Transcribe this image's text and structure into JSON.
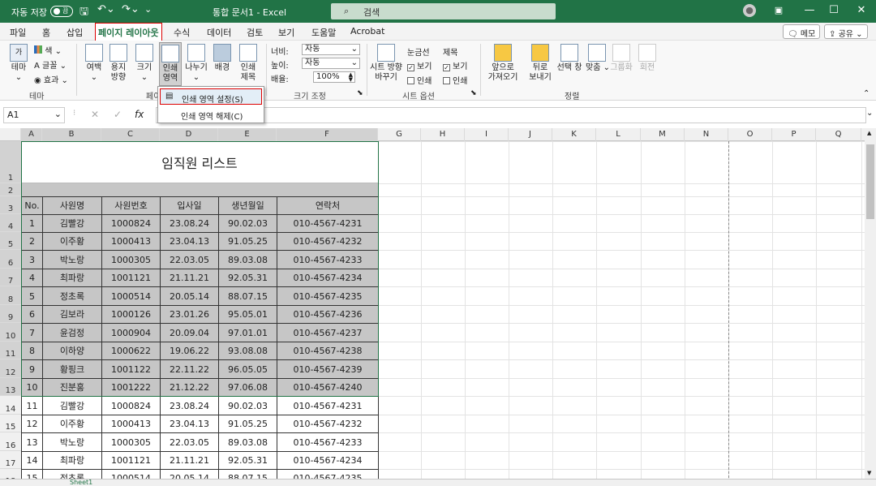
{
  "titlebar": {
    "autosave": "자동 저장",
    "autosave_state": "끔",
    "title": "통합 문서1  -  Excel",
    "search": "검색"
  },
  "menu": {
    "tabs": [
      "파일",
      "홈",
      "삽입",
      "페이지 레이아웃",
      "수식",
      "데이터",
      "검토",
      "보기",
      "도움말",
      "Acrobat"
    ],
    "selected": "페이지 레이아웃",
    "memo": "메모",
    "share": "공유"
  },
  "ribbon": {
    "theme": {
      "themes": "테마",
      "colors": "색",
      "fonts": "글꼴",
      "effects": "효과",
      "group": "테마"
    },
    "page_setup": {
      "margins": "여백",
      "orientation": "용지\n방향",
      "size": "크기",
      "print_area": "인쇄\n영역",
      "breaks": "나누기",
      "background": "배경",
      "print_titles": "인쇄\n제목",
      "group": "페이"
    },
    "scale": {
      "width_label": "너비:",
      "width_value": "자동",
      "height_label": "높이:",
      "height_value": "자동",
      "scale_label": "배율:",
      "scale_value": "100%",
      "group": "크기 조정"
    },
    "sheet_options": {
      "switch": "시트 방향\n바꾸기",
      "gridlines": "눈금선",
      "headings": "제목",
      "view": "보기",
      "print": "인쇄",
      "group": "시트 옵션"
    },
    "arrange": {
      "bring_forward": "앞으로\n가져오기",
      "send_backward": "뒤로\n보내기",
      "selection_pane": "선택 창",
      "align": "맞춤",
      "group_btn": "그룹화",
      "rotate": "회전",
      "group": "정렬"
    }
  },
  "popup": {
    "set": "인쇄 영역 설정(S)",
    "clear": "인쇄 영역 해제(C)"
  },
  "namebox": "A1",
  "columns": [
    "A",
    "B",
    "C",
    "D",
    "E",
    "F",
    "G",
    "H",
    "I",
    "J",
    "K",
    "L",
    "M",
    "N",
    "O",
    "P",
    "Q"
  ],
  "sheet": {
    "title": "임직원 리스트",
    "headers": [
      "No.",
      "사원명",
      "사원번호",
      "입사일",
      "생년월일",
      "연락처"
    ],
    "rows": [
      [
        "1",
        "김빨강",
        "1000824",
        "23.08.24",
        "90.02.03",
        "010-4567-4231"
      ],
      [
        "2",
        "이주황",
        "1000413",
        "23.04.13",
        "91.05.25",
        "010-4567-4232"
      ],
      [
        "3",
        "박노랑",
        "1000305",
        "22.03.05",
        "89.03.08",
        "010-4567-4233"
      ],
      [
        "4",
        "최파랑",
        "1001121",
        "21.11.21",
        "92.05.31",
        "010-4567-4234"
      ],
      [
        "5",
        "정초록",
        "1000514",
        "20.05.14",
        "88.07.15",
        "010-4567-4235"
      ],
      [
        "6",
        "김보라",
        "1000126",
        "23.01.26",
        "95.05.01",
        "010-4567-4236"
      ],
      [
        "7",
        "윤검정",
        "1000904",
        "20.09.04",
        "97.01.01",
        "010-4567-4237"
      ],
      [
        "8",
        "이하양",
        "1000622",
        "19.06.22",
        "93.08.08",
        "010-4567-4238"
      ],
      [
        "9",
        "황핑크",
        "1001122",
        "22.11.22",
        "96.05.05",
        "010-4567-4239"
      ],
      [
        "10",
        "진분홍",
        "1001222",
        "21.12.22",
        "97.06.08",
        "010-4567-4240"
      ],
      [
        "11",
        "김빨강",
        "1000824",
        "23.08.24",
        "90.02.03",
        "010-4567-4231"
      ],
      [
        "12",
        "이주황",
        "1000413",
        "23.04.13",
        "91.05.25",
        "010-4567-4232"
      ],
      [
        "13",
        "박노랑",
        "1000305",
        "22.03.05",
        "89.03.08",
        "010-4567-4233"
      ],
      [
        "14",
        "최파랑",
        "1001121",
        "21.11.21",
        "92.05.31",
        "010-4567-4234"
      ],
      [
        "15",
        "정초록",
        "1000514",
        "20.05.14",
        "88.07.15",
        "010-4567-4235"
      ]
    ],
    "row_numbers": [
      "1",
      "2",
      "3",
      "4",
      "5",
      "6",
      "7",
      "8",
      "9",
      "10",
      "11",
      "12",
      "13",
      "14",
      "15"
    ],
    "selected_rows": 10
  },
  "sheet_tab": "Sheet1",
  "colors": {
    "excel_green": "#217346",
    "selection_fill": "#c6c6c6",
    "highlight_red": "#dd0000"
  }
}
